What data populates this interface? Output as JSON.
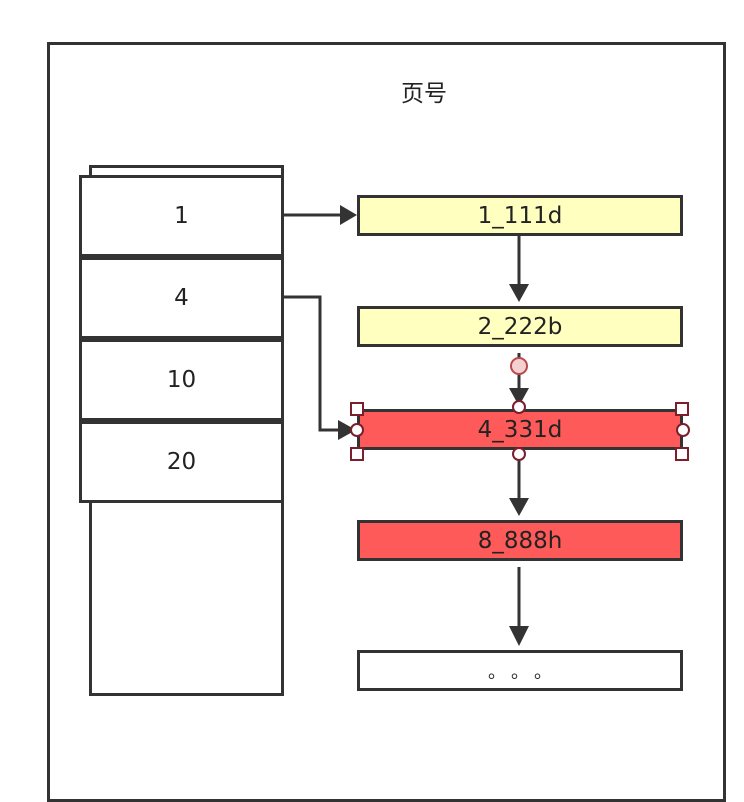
{
  "diagram": {
    "title": "页号",
    "index_cells": [
      {
        "label": "1"
      },
      {
        "label": "4"
      },
      {
        "label": "10"
      },
      {
        "label": "20"
      }
    ],
    "nodes": [
      {
        "label": "1_111d",
        "fill": "#ffffc0"
      },
      {
        "label": "2_222b",
        "fill": "#ffffc0"
      },
      {
        "label": "4_331d",
        "fill": "#ff5a5a",
        "selected": true
      },
      {
        "label": "8_888h",
        "fill": "#ff5a5a"
      },
      {
        "label": "。。。",
        "fill": "#ffffff"
      }
    ],
    "colors": {
      "stroke": "#333333",
      "selection_handle": "#7a1f2b"
    }
  }
}
